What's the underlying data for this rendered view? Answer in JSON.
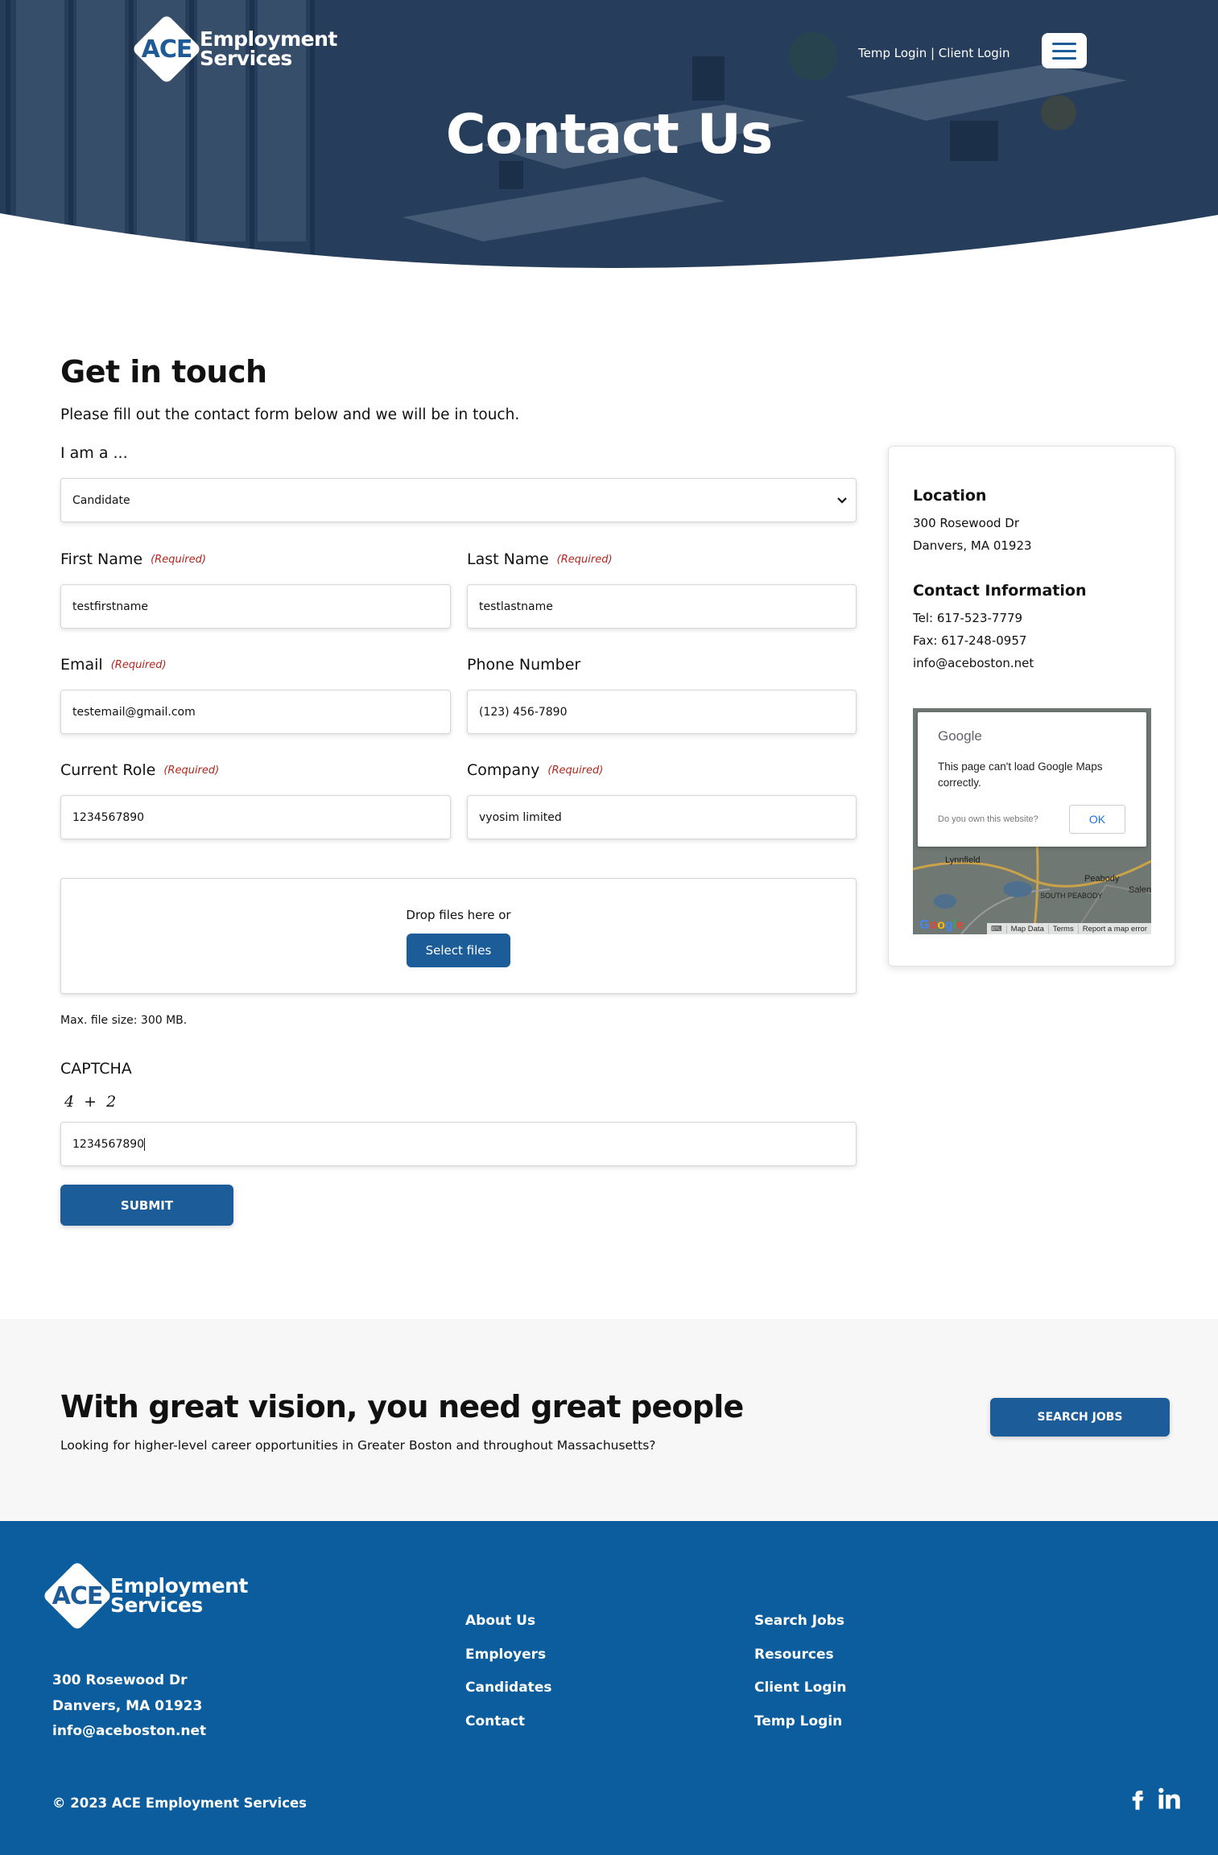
{
  "header": {
    "logo_short": "ACE",
    "logo_line1": "Employment",
    "logo_line2": "Services",
    "top_links": "Temp Login | Client Login",
    "menu_icon": "hamburger-icon",
    "page_title": "Contact Us"
  },
  "form": {
    "heading": "Get in touch",
    "intro": "Please fill out the contact form below and we will be in touch.",
    "role_label": "I am a ...",
    "role_value": "Candidate",
    "required_text": "(Required)",
    "first_name_label": "First Name",
    "first_name_value": "testfirstname",
    "last_name_label": "Last Name",
    "last_name_value": "testlastname",
    "email_label": "Email",
    "email_value": "testemail@gmail.com",
    "phone_label": "Phone Number",
    "phone_value": "(123) 456-7890",
    "current_role_label": "Current Role",
    "current_role_value": "1234567890",
    "company_label": "Company",
    "company_value": "vyosim limited",
    "drop_text": "Drop files here or",
    "select_files": "Select files",
    "max_size": "Max. file size: 300 MB.",
    "captcha_label": "CAPTCHA",
    "captcha_question": "4 + 2",
    "captcha_value": "1234567890",
    "submit": "SUBMIT"
  },
  "sidebar": {
    "location_heading": "Location",
    "address_line1": "300 Rosewood Dr",
    "address_line2": "Danvers, MA 01923",
    "contact_heading": "Contact Information",
    "tel": "Tel: 617-523-7779",
    "fax": "Fax: 617-248-0957",
    "email": "info@aceboston.net",
    "map": {
      "dialog_brand": "Google",
      "dialog_message": "This page can't load Google Maps correctly.",
      "dialog_own": "Do you own this website?",
      "dialog_ok": "OK",
      "label_lynnfield": "Lynnfield",
      "label_peabody": "Peabody",
      "label_south_peabody": "SOUTH PEABODY",
      "label_salem": "Salen",
      "footer_map_data": "Map Data",
      "footer_terms": "Terms",
      "footer_report": "Report a map error",
      "logo": "Google"
    }
  },
  "cta": {
    "heading": "With great vision, you need great people",
    "text": "Looking for higher-level career opportunities in Greater Boston and throughout Massachusetts?",
    "button": "SEARCH JOBS"
  },
  "footer": {
    "address_line1": "300 Rosewood Dr",
    "address_line2": "Danvers, MA 01923",
    "email": "info@aceboston.net",
    "links_col1": [
      "About Us",
      "Employers",
      "Candidates",
      "Contact"
    ],
    "links_col2": [
      "Search Jobs",
      "Resources",
      "Client Login",
      "Temp Login"
    ],
    "copyright": "© 2023 ACE Employment Services",
    "social_icons": [
      "facebook-icon",
      "linkedin-icon"
    ]
  },
  "colors": {
    "brand_blue": "#1b5c99",
    "footer_blue": "#0b5d9d",
    "required_red": "#b3261e",
    "cta_bg": "#f7f7f7"
  }
}
